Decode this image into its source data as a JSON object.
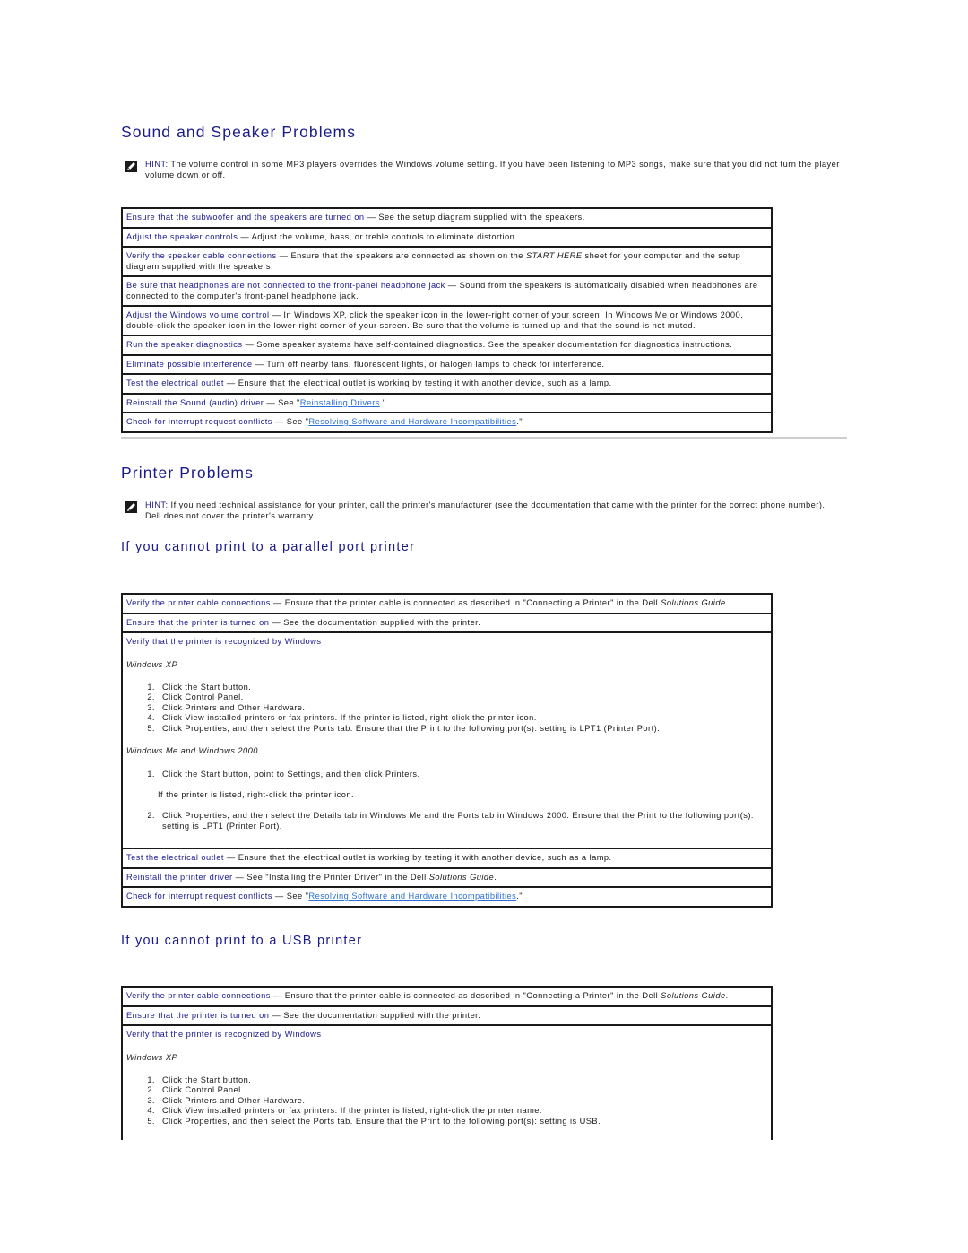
{
  "sound": {
    "title": "Sound and Speaker Problems",
    "hint_label": "HINT:",
    "hint_text": " The volume control in some MP3 players overrides the Windows volume setting. If you have been listening to MP3 songs, make sure that you did not turn the player volume down or off.",
    "rows": [
      {
        "lead": "Ensure that the subwoofer and the speakers are turned on",
        "text": "See the setup diagram supplied with the speakers."
      },
      {
        "lead": "Adjust the speaker controls",
        "text": "Adjust the volume, bass, or treble controls to eliminate distortion."
      },
      {
        "lead": "Verify the speaker cable connections",
        "text_before": "Ensure that the speakers are connected as shown on the ",
        "italic": "START HERE",
        "text_after": " sheet for your computer and the setup diagram supplied with the speakers."
      },
      {
        "lead": "Be sure that headphones are not connected to the front-panel headphone jack",
        "text": "Sound from the speakers is automatically disabled when headphones are connected to the computer's front-panel headphone jack."
      },
      {
        "lead": "Adjust the Windows volume control",
        "text": "In Windows XP, click the speaker icon in the lower-right corner of your screen. In Windows Me or Windows 2000, double-click the speaker icon in the lower-right corner of your screen. Be sure that the volume is turned up and that the sound is not muted."
      },
      {
        "lead": "Run the speaker diagnostics",
        "text": "Some speaker systems have self-contained diagnostics. See the speaker documentation for diagnostics instructions."
      },
      {
        "lead": "Eliminate possible interference",
        "text": "Turn off nearby fans, fluorescent lights, or halogen lamps to check for interference."
      },
      {
        "lead": "Test the electrical outlet",
        "text": "Ensure that the electrical outlet is working by testing it with another device, such as a lamp."
      },
      {
        "lead": "Reinstall the Sound (audio) driver",
        "see": "See \"",
        "link": "Reinstalling Drivers",
        "end": ".\""
      },
      {
        "lead": "Check for interrupt request conflicts",
        "see": "See \"",
        "link": "Resolving Software and Hardware Incompatibilities",
        "end": ".\""
      }
    ]
  },
  "printer": {
    "title": "Printer Problems",
    "hint_label": "HINT:",
    "hint_text": " If you need technical assistance for your printer, call the printer's manufacturer (see the documentation that came with the printer for the correct phone number). Dell does not cover the printer's warranty.",
    "parallel": {
      "title": "If you cannot print to a parallel port printer",
      "row_cable": {
        "lead": "Verify the printer cable connections",
        "text_before": "Ensure that the printer cable is connected as described in \"Connecting a Printer\" in the Dell ",
        "italic": "Solutions Guide",
        "text_after": "."
      },
      "row_on": {
        "lead": "Ensure that the printer is turned on",
        "text": "See the documentation supplied with the printer."
      },
      "row_recognized": {
        "lead": "Verify that the printer is recognized by Windows",
        "xp_label": "Windows XP",
        "xp_steps": [
          "Click the Start button.",
          "Click Control Panel.",
          "Click Printers and Other Hardware.",
          "Click View installed printers or fax printers. If the printer is listed, right-click the printer icon.",
          "Click Properties, and then select the Ports tab. Ensure that the Print to the following port(s): setting is LPT1 (Printer Port)."
        ],
        "me_label": "Windows Me and Windows 2000",
        "me_step1": "Click the Start button, point to Settings, and then click Printers.",
        "me_step1_sub": "If the printer is listed, right-click the printer icon.",
        "me_step2": "Click Properties, and then select the Details tab in Windows Me and the Ports tab in Windows 2000. Ensure that the Print to the following port(s): setting is LPT1 (Printer Port)."
      },
      "row_outlet": {
        "lead": "Test the electrical outlet",
        "text": "Ensure that the electrical outlet is working by testing it with another device, such as a lamp."
      },
      "row_driver": {
        "lead": "Reinstall the printer driver",
        "text_before": "See \"Installing the Printer Driver\" in the Dell ",
        "italic": "Solutions Guide",
        "text_after": "."
      },
      "row_irq": {
        "lead": "Check for interrupt request conflicts",
        "see": "See \"",
        "link": "Resolving Software and Hardware Incompatibilities",
        "end": ".\""
      }
    },
    "usb": {
      "title": "If you cannot print to a USB printer",
      "row_cable": {
        "lead": "Verify the printer cable connections",
        "text_before": "Ensure that the printer cable is connected as described in \"Connecting a Printer\" in the Dell ",
        "italic": "Solutions Guide",
        "text_after": "."
      },
      "row_on": {
        "lead": "Ensure that the printer is turned on",
        "text": "See the documentation supplied with the printer."
      },
      "row_recognized": {
        "lead": "Verify that the printer is recognized by Windows",
        "xp_label": "Windows XP",
        "xp_steps": [
          "Click the Start button.",
          "Click Control Panel.",
          "Click Printers and Other Hardware.",
          "Click View installed printers or fax printers. If the printer is listed, right-click the printer name.",
          "Click Properties, and then select the Ports tab. Ensure that the Print to the following port(s): setting is USB."
        ]
      }
    }
  },
  "dash": " — "
}
